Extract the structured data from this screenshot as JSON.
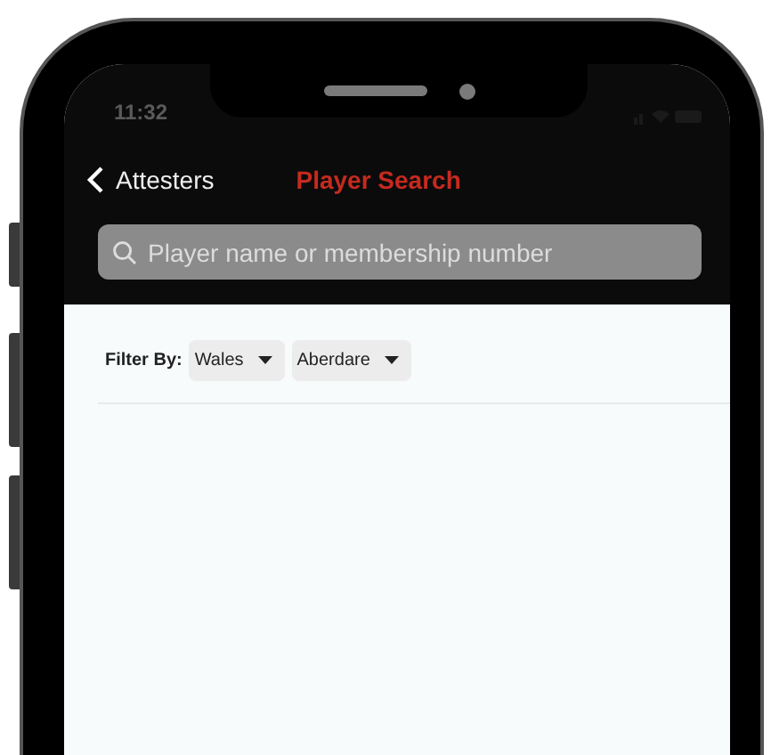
{
  "status_bar": {
    "time": "11:32"
  },
  "nav": {
    "back_label": "Attesters",
    "title": "Player Search"
  },
  "search": {
    "placeholder": "Player name or membership number"
  },
  "filter": {
    "label": "Filter By:",
    "dropdowns": [
      {
        "value": "Wales"
      },
      {
        "value": "Aberdare"
      }
    ]
  }
}
